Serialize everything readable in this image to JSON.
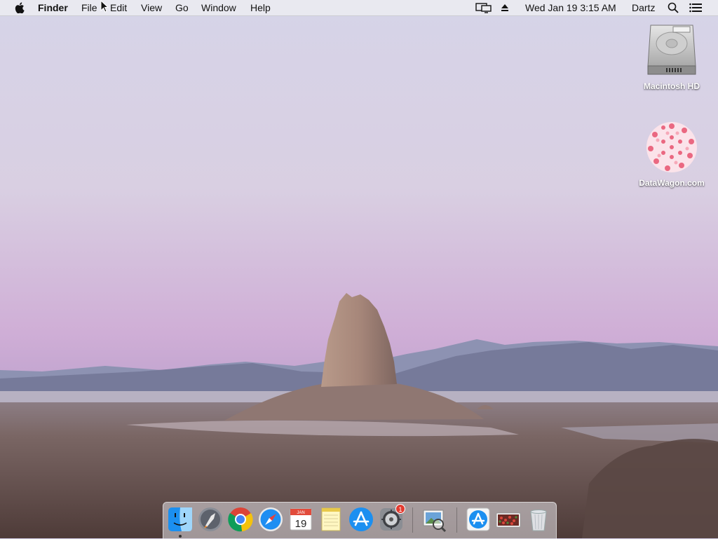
{
  "menubar": {
    "apple_icon": "apple-logo-icon",
    "app_name": "Finder",
    "menus": [
      "File",
      "Edit",
      "View",
      "Go",
      "Window",
      "Help"
    ],
    "status": {
      "display_icon": "display-mirroring-icon",
      "eject_icon": "eject-icon",
      "clock": "Wed Jan 19  3:15 AM",
      "user": "Dartz",
      "search_icon": "spotlight-search-icon",
      "notification_icon": "notification-center-icon"
    }
  },
  "desktop": {
    "icons": [
      {
        "label": "Macintosh HD",
        "icon": "hard-drive-icon"
      },
      {
        "label": "DataWagon.com",
        "icon": "datawagon-icon"
      }
    ]
  },
  "dock": {
    "calendar": {
      "month": "JAN",
      "day": "19"
    },
    "system_preferences_badge": "1",
    "items": [
      "finder-icon",
      "launchpad-icon",
      "chrome-icon",
      "safari-icon",
      "calendar-icon",
      "notes-icon",
      "app-store-icon",
      "system-preferences-icon",
      "preview-icon",
      "app-store-downloads-icon",
      "photo-stack-icon",
      "trash-icon"
    ]
  },
  "colors": {
    "sky_top": "#d4d2e6",
    "sky_bottom": "#c499c6",
    "mountains": "#7c7f9f",
    "rock": "#a5877b",
    "ground": "#6a5652",
    "badge": "#e23b30"
  }
}
